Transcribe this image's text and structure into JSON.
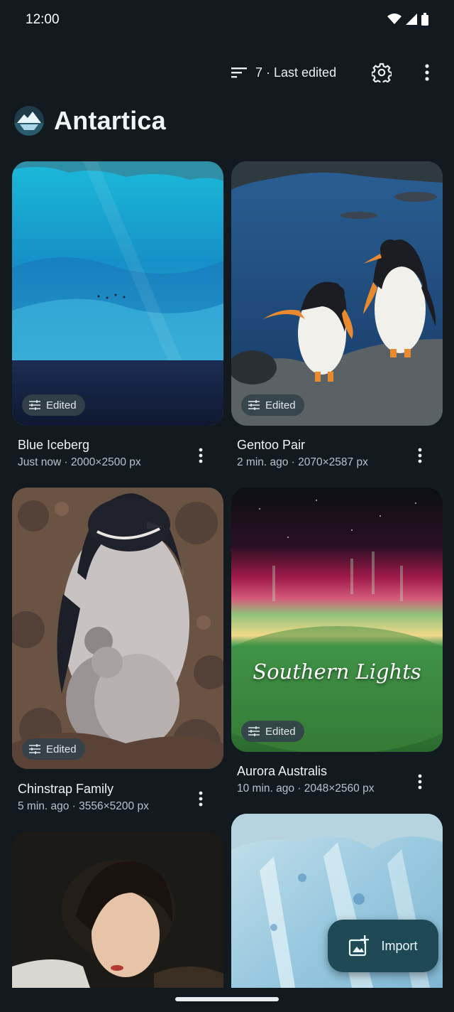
{
  "status_bar": {
    "time": "12:00"
  },
  "toolbar": {
    "sort_label": "7 · Last edited"
  },
  "album": {
    "title": "Antartica"
  },
  "photos": [
    {
      "title": "Blue Iceberg",
      "meta": "Just now · 2000×2500 px",
      "badge": "Edited"
    },
    {
      "title": "Gentoo Pair",
      "meta": "2 min. ago · 2070×2587 px",
      "badge": "Edited"
    },
    {
      "title": "Chinstrap Family",
      "meta": "5 min. ago · 3556×5200 px",
      "badge": "Edited"
    },
    {
      "title": "Aurora Australis",
      "meta": "10 min. ago · 2048×2560 px",
      "badge": "Edited",
      "overlay_text": "Southern Lights"
    }
  ],
  "fab": {
    "import_label": "Import"
  },
  "icons": {
    "sort": "sort-icon",
    "settings": "gear-icon",
    "more": "more-vert-icon",
    "edited": "tune-icon",
    "import": "add-photo-icon",
    "album": "iceberg-logo-icon"
  },
  "colors": {
    "background": "#121a20",
    "fab": "#1f4a55",
    "chip": "#34424a"
  }
}
